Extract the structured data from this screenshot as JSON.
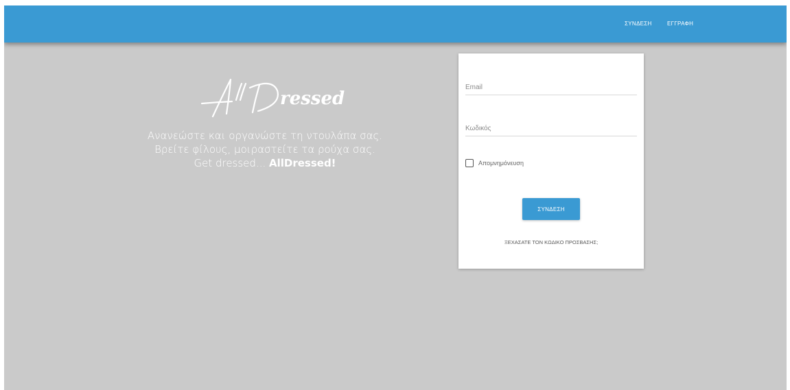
{
  "nav": {
    "login": "ΣΥΝΔΕΣΗ",
    "register": "ΕΓΓΡΑΦΗ"
  },
  "brand": {
    "logo_text": "AllDressed"
  },
  "hero": {
    "line1": "Ανανεώστε και οργανώστε τη ντουλάπα σας.",
    "line2": "Βρείτε φίλους, μοιραστείτε τα ρούχα σας.",
    "line3_prefix": "Get dressed... ",
    "line3_brand": "AllDressed!"
  },
  "login_form": {
    "email_placeholder": "Email",
    "password_placeholder": "Κωδικός",
    "remember_label": "Απομνημόνευση",
    "remember_checked": false,
    "submit_label": "ΣΥΝΔΕΣΗ",
    "forgot_password": "ΞΕΧΑΣΑΤΕ ΤΟΝ ΚΩΔΙΚΟ ΠΡΟΣΒΑΣΗΣ;"
  },
  "colors": {
    "primary": "#3a9ad3",
    "background": "#cacaca",
    "card": "#ffffff"
  }
}
